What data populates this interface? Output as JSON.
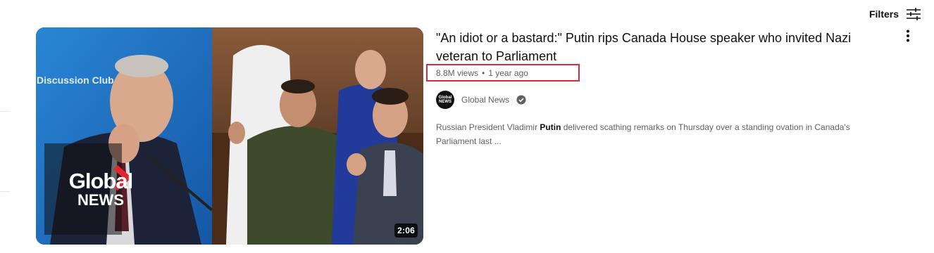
{
  "filters": {
    "label": "Filters",
    "icon": "sliders-icon"
  },
  "video": {
    "title": "\"An idiot or a bastard:\" Putin rips Canada House speaker who invited Nazi veteran to Parliament",
    "views": "8.8M views",
    "separator": "•",
    "age": "1 year ago",
    "duration": "2:06",
    "channel": {
      "name": "Global News",
      "avatar_text": "Global NEWS",
      "verified": true
    },
    "description_parts": {
      "before": "Russian President Vladimir ",
      "bold": "Putin",
      "after": " delivered scathing remarks on Thursday over a standing ovation in Canada's Parliament last ..."
    },
    "thumbnail": {
      "logo_line1": "Global",
      "logo_line2": "NEWS",
      "backdrop_text": "Discussion Club"
    }
  },
  "colors": {
    "highlight_box": "#d32f3a",
    "logo_chevron": "#e4262f",
    "thumb_left_bg": "#1d6fc1",
    "thumb_right_bg": "#6b3a22"
  }
}
